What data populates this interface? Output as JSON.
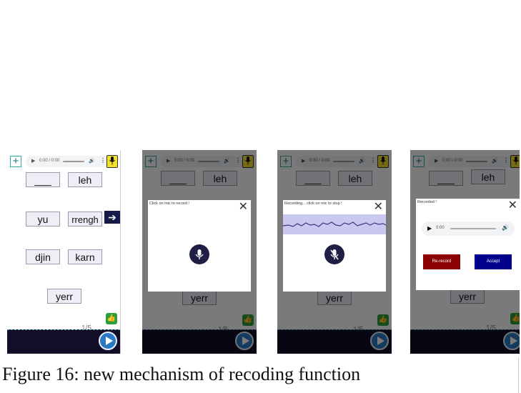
{
  "caption": "Figure 16: new mechanism of recoding function",
  "app": {
    "audio_time": "0:00 / 0:00",
    "words": [
      "___",
      "leh",
      "yu",
      "rrengh",
      "djin",
      "karn",
      "yerr"
    ],
    "counter": "1/5"
  },
  "modals": {
    "record_prompt": "Click on mic to record !",
    "recording_prompt": "Recording... click on mic to stop !",
    "recorded_prompt": "Recorded !",
    "player_time": "0:00",
    "rerecord_label": "Re-record",
    "accept_label": "Accept"
  },
  "colors": {
    "footer": "#140d28",
    "mic_yellow": "#f2e02a",
    "rerecord_red": "#8b0000",
    "accept_blue": "#00008b",
    "wave_band": "#c8c8f0"
  }
}
